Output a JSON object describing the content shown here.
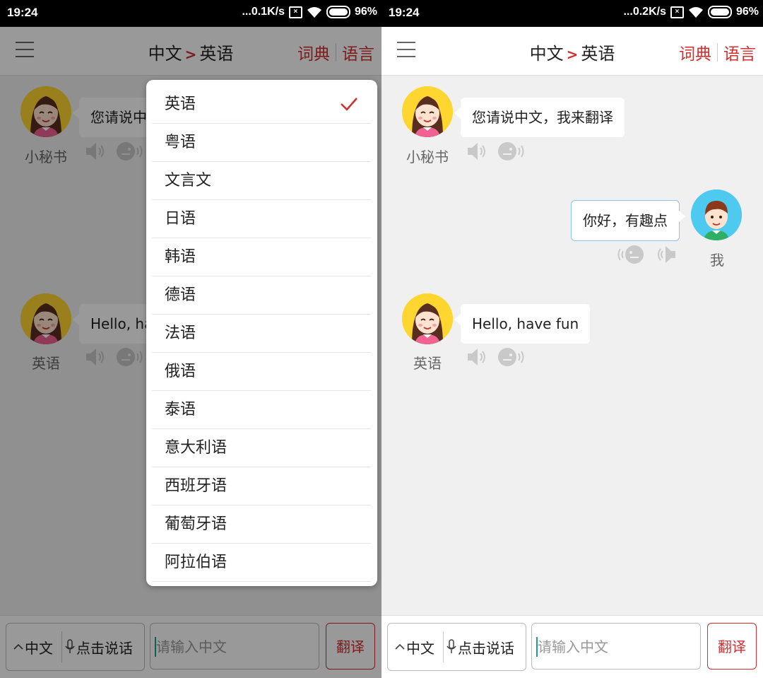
{
  "left": {
    "status": {
      "time": "19:24",
      "speed": "...0.1K/s",
      "battery": "96%"
    },
    "header": {
      "title_from": "中文",
      "title_sep": ">",
      "title_to": "英语",
      "dict_label": "词典",
      "lang_label": "语言"
    },
    "messages": [
      {
        "name": "小秘书",
        "text": "您请说中文，我来翻译"
      },
      {
        "name": "英语",
        "text": "Hello, have fun"
      }
    ],
    "dropdown": {
      "selected_index": 0,
      "items": [
        "英语",
        "粤语",
        "文言文",
        "日语",
        "韩语",
        "德语",
        "法语",
        "俄语",
        "泰语",
        "意大利语",
        "西班牙语",
        "葡萄牙语",
        "阿拉伯语"
      ]
    },
    "bottom": {
      "lang_selector": "中文",
      "mic_label": "点击说话",
      "input_placeholder": "请输入中文",
      "translate_label": "翻译"
    }
  },
  "right": {
    "status": {
      "time": "19:24",
      "speed": "...0.2K/s",
      "battery": "96%"
    },
    "header": {
      "title_from": "中文",
      "title_sep": ">",
      "title_to": "英语",
      "dict_label": "词典",
      "lang_label": "语言"
    },
    "messages": [
      {
        "name": "小秘书",
        "text": "您请说中文，我来翻译"
      },
      {
        "name": "我",
        "text": "你好，有趣点"
      },
      {
        "name": "英语",
        "text": "Hello, have fun"
      }
    ],
    "bottom": {
      "lang_selector": "中文",
      "mic_label": "点击说话",
      "input_placeholder": "请输入中文",
      "translate_label": "翻译"
    }
  },
  "colors": {
    "accent_red": "#d32f2f",
    "girl_avatar_bg": "#ffd630",
    "boy_avatar_bg": "#4ec9f0",
    "cursor_teal": "#1aa08a"
  },
  "icons": [
    "menu-icon",
    "speaker-icon",
    "voice-head-icon",
    "check-icon",
    "chevron-up-icon",
    "microphone-icon",
    "wifi-icon",
    "battery-icon",
    "close-box-icon"
  ]
}
